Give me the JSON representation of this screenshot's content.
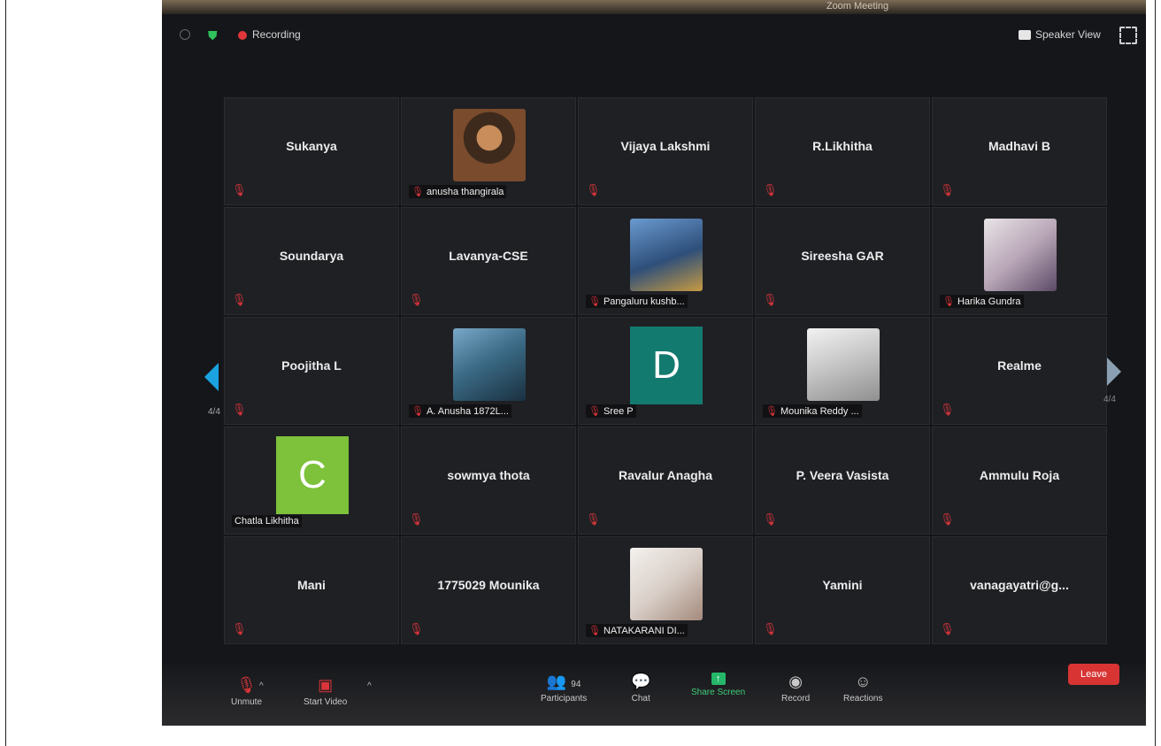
{
  "window": {
    "title": "Zoom Meeting"
  },
  "topbar": {
    "recording_label": "Recording",
    "speaker_view_label": "Speaker View"
  },
  "pagination": {
    "left": "4/4",
    "right": "4/4"
  },
  "tiles": [
    {
      "kind": "name",
      "name": "Sukanya"
    },
    {
      "kind": "photo",
      "name": "anusha thangirala",
      "avatar": "av-a"
    },
    {
      "kind": "name",
      "name": "Vijaya Lakshmi"
    },
    {
      "kind": "name",
      "name": "R.Likhitha"
    },
    {
      "kind": "name",
      "name": "Madhavi B"
    },
    {
      "kind": "name",
      "name": "Soundarya"
    },
    {
      "kind": "name",
      "name": "Lavanya-CSE"
    },
    {
      "kind": "photo",
      "name": "Pangaluru kushb...",
      "avatar": "av-b"
    },
    {
      "kind": "name",
      "name": "Sireesha GAR"
    },
    {
      "kind": "photo",
      "name": "Harika Gundra",
      "avatar": "av-c"
    },
    {
      "kind": "name",
      "name": "Poojitha L"
    },
    {
      "kind": "photo",
      "name": "A. Anusha 1872L...",
      "avatar": "av-d"
    },
    {
      "kind": "letter",
      "name": "Sree P",
      "letter": "D",
      "color": "#137a70"
    },
    {
      "kind": "photo",
      "name": "Mounika Reddy ...",
      "avatar": "av-e"
    },
    {
      "kind": "name",
      "name": "Realme"
    },
    {
      "kind": "letter",
      "name": "Chatla Likhitha",
      "letter": "C",
      "color": "#7dc23a",
      "nomic": true
    },
    {
      "kind": "name",
      "name": "sowmya thota"
    },
    {
      "kind": "name",
      "name": "Ravalur Anagha"
    },
    {
      "kind": "name",
      "name": "P. Veera Vasista"
    },
    {
      "kind": "name",
      "name": "Ammulu Roja"
    },
    {
      "kind": "name",
      "name": "Mani"
    },
    {
      "kind": "name",
      "name": "1775029 Mounika"
    },
    {
      "kind": "photo",
      "name": "NATAKARANI DI...",
      "avatar": "av-f"
    },
    {
      "kind": "name",
      "name": "Yamini"
    },
    {
      "kind": "name",
      "name": "vanagayatri@g..."
    }
  ],
  "toolbar": {
    "unmute": "Unmute",
    "start_video": "Start Video",
    "participants": "Participants",
    "participants_count": "94",
    "chat": "Chat",
    "share_screen": "Share Screen",
    "record": "Record",
    "reactions": "Reactions",
    "leave": "Leave"
  },
  "colors": {
    "recording": "#e0373a",
    "share": "#26b86a",
    "leave": "#d83434",
    "mute": "#d8343a"
  }
}
